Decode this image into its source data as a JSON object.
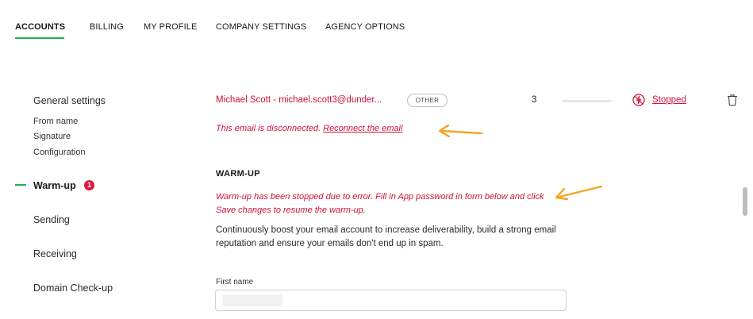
{
  "tabs": [
    {
      "label": "ACCOUNTS",
      "active": true
    },
    {
      "label": "BILLING",
      "active": false
    },
    {
      "label": "MY PROFILE",
      "active": false
    },
    {
      "label": "COMPANY SETTINGS",
      "active": false
    },
    {
      "label": "AGENCY OPTIONS",
      "active": false
    }
  ],
  "sidebar": {
    "general": "General settings",
    "sub_items": [
      "From name",
      "Signature",
      "Configuration"
    ],
    "warmup": "Warm-up",
    "warmup_badge": "1",
    "sending": "Sending",
    "receiving": "Receiving",
    "domain_checkup": "Domain Check-up"
  },
  "account": {
    "name_email": "Michael Scott - michael.scott3@dunder...",
    "tag": "OTHER",
    "count": "3",
    "status": "Stopped",
    "status_icon": "lightning-slash-icon",
    "delete_icon": "trash-icon"
  },
  "alerts": {
    "disconnected_text": "This email is disconnected. ",
    "reconnect_link": "Reconnect the email"
  },
  "warmup": {
    "title": "WARM-UP",
    "error": "Warm-up has been stopped due to error. Fill in App password in form below and click Save changes to resume the warm-up.",
    "description": "Continuously boost your email account to increase deliverability, build a strong email reputation and ensure your emails don't end up in spam."
  },
  "form": {
    "first_name_label": "First name",
    "first_name_value": ""
  },
  "colors": {
    "accent_green": "#22b14c",
    "error_red": "#d0103a",
    "badge_red": "#e0163f",
    "annotation_orange": "#f5a623"
  }
}
